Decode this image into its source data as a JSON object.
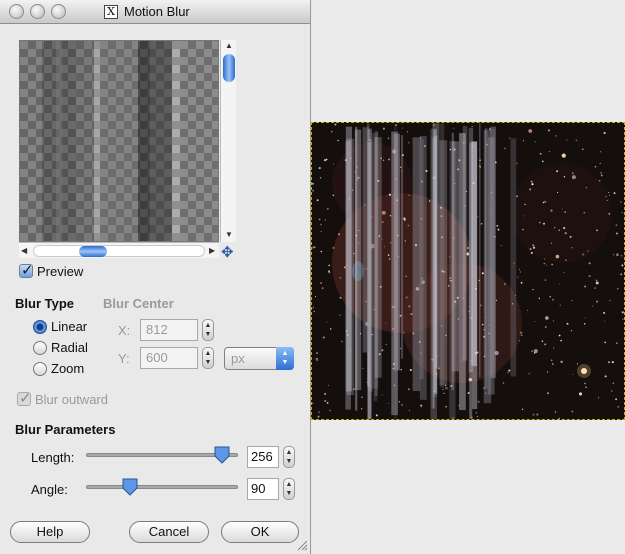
{
  "window": {
    "title": "Motion Blur",
    "title_icon": "X"
  },
  "preview": {
    "checkbox_label": "Preview",
    "checked": true
  },
  "blur_type": {
    "heading": "Blur Type",
    "options": [
      {
        "label": "Linear",
        "selected": true
      },
      {
        "label": "Radial",
        "selected": false
      },
      {
        "label": "Zoom",
        "selected": false
      }
    ]
  },
  "blur_center": {
    "heading": "Blur Center",
    "x_label": "X:",
    "x_value": "812",
    "y_label": "Y:",
    "y_value": "600",
    "unit": "px"
  },
  "blur_outward": {
    "label": "Blur outward",
    "checked": true,
    "enabled": false
  },
  "blur_parameters": {
    "heading": "Blur Parameters",
    "length_label": "Length:",
    "length_value": "256",
    "angle_label": "Angle:",
    "angle_value": "90"
  },
  "buttons": {
    "help": "Help",
    "cancel": "Cancel",
    "ok": "OK"
  },
  "colors": {
    "accent_blue": "#2c6bd3",
    "selection_border": "#c9b000"
  }
}
